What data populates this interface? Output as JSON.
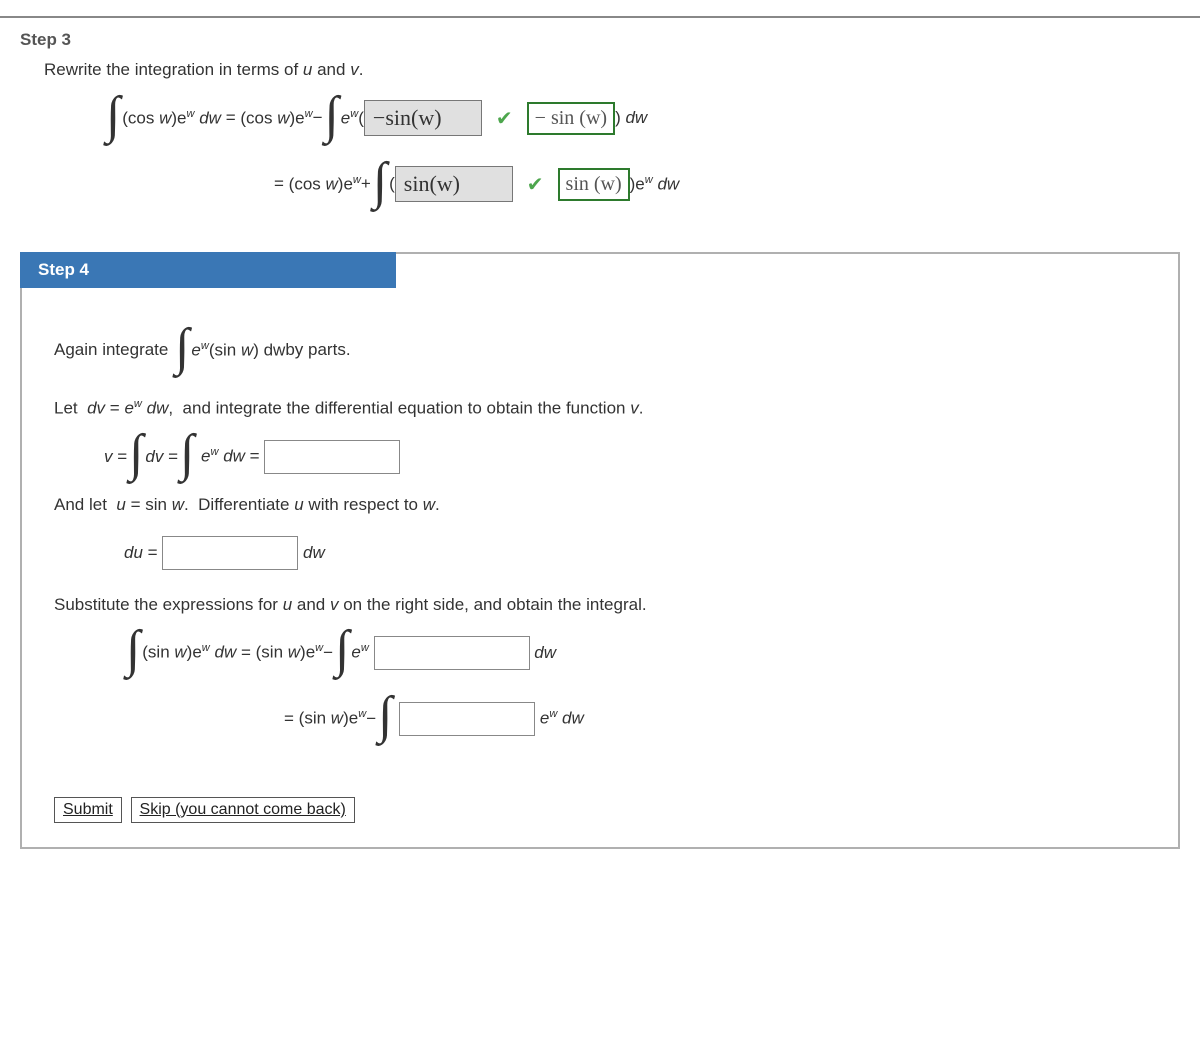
{
  "step3": {
    "title": "Step 3",
    "intro": "Rewrite the integration in terms of u and v.",
    "row1": {
      "lhs_a": "(cos ",
      "lhs_b": ")e",
      "lhs_c": " dw",
      "eq": "=",
      "mid_a": "(cos ",
      "mid_b": ")e",
      "minus": " − ",
      "ew_open": "e",
      "open_paren": "(",
      "filled": "−sin(w)",
      "correct": "− sin (w)",
      "close_paren": ") ",
      "dw": "dw"
    },
    "row2": {
      "eq": "=",
      "mid_a": "(cos ",
      "mid_b": ")e",
      "plus": " + ",
      "open_paren": "( ",
      "filled": "sin(w)",
      "correct": "sin (w)",
      "close_paren": ")e",
      "dw": " dw"
    }
  },
  "step4": {
    "title": "Step 4",
    "intro_a": "Again integrate ",
    "intro_b": "e",
    "intro_c": "(sin ",
    "intro_d": ") dw",
    "intro_e": "  by parts.",
    "let_dv": "Let  dv = e",
    "let_dv2": " dw,  and integrate the differential equation to obtain the function v.",
    "v_eq": "v = ",
    "dv_eq": " dv = ",
    "ew_dw_eq": " e",
    "ew_dw_eq2": " dw = ",
    "and_let": "And let  u = sin w.  Differentiate u with respect to w.",
    "du_eq": "du = ",
    "du_dw": " dw",
    "subst": "Substitute the expressions for u and v on the right side, and obtain the integral.",
    "srow1": {
      "lhs_a": "(sin ",
      "lhs_b": ")e",
      "lhs_c": " dw",
      "eq": "=",
      "mid_a": "(sin ",
      "mid_b": ")e",
      "minus": " − ",
      "ew": "e",
      "dw": " dw"
    },
    "srow2": {
      "eq": "=",
      "mid_a": "(sin ",
      "mid_b": ")e",
      "minus": " − ",
      "ew_dw": " e",
      "ew_dw2": " dw"
    },
    "submit": "Submit",
    "skip": "Skip (you cannot come back)"
  },
  "sym": {
    "w": "w",
    "W": "w"
  }
}
